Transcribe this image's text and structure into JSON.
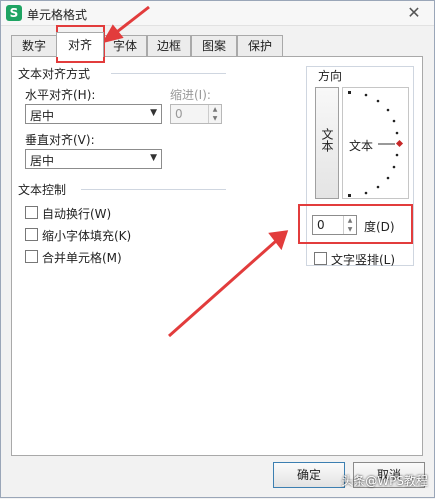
{
  "window": {
    "title": "单元格格式",
    "app_icon": "S"
  },
  "tabs": [
    {
      "label": "数字"
    },
    {
      "label": "对齐"
    },
    {
      "label": "字体"
    },
    {
      "label": "边框"
    },
    {
      "label": "图案"
    },
    {
      "label": "保护"
    }
  ],
  "alignment": {
    "group_label": "文本对齐方式",
    "horizontal_label": "水平对齐(H):",
    "horizontal_value": "居中",
    "indent_label": "缩进(I):",
    "indent_value": "0",
    "vertical_label": "垂直对齐(V):",
    "vertical_value": "居中"
  },
  "text_control": {
    "group_label": "文本控制",
    "options": [
      {
        "label": "自动换行(W)"
      },
      {
        "label": "缩小字体填充(K)"
      },
      {
        "label": "合并单元格(M)"
      }
    ]
  },
  "orientation": {
    "title": "方向",
    "vertical_text_label": "文本",
    "dial_text": "文本",
    "degrees_value": "0",
    "degrees_label": "度(D)",
    "vertical_stack_label": "文字竖排(L)"
  },
  "buttons": {
    "ok": "确定",
    "cancel": "取消"
  },
  "watermark": "头条@WPS教程",
  "colors": {
    "annotation": "#e23c3c",
    "app_icon_bg": "#1fa463"
  }
}
